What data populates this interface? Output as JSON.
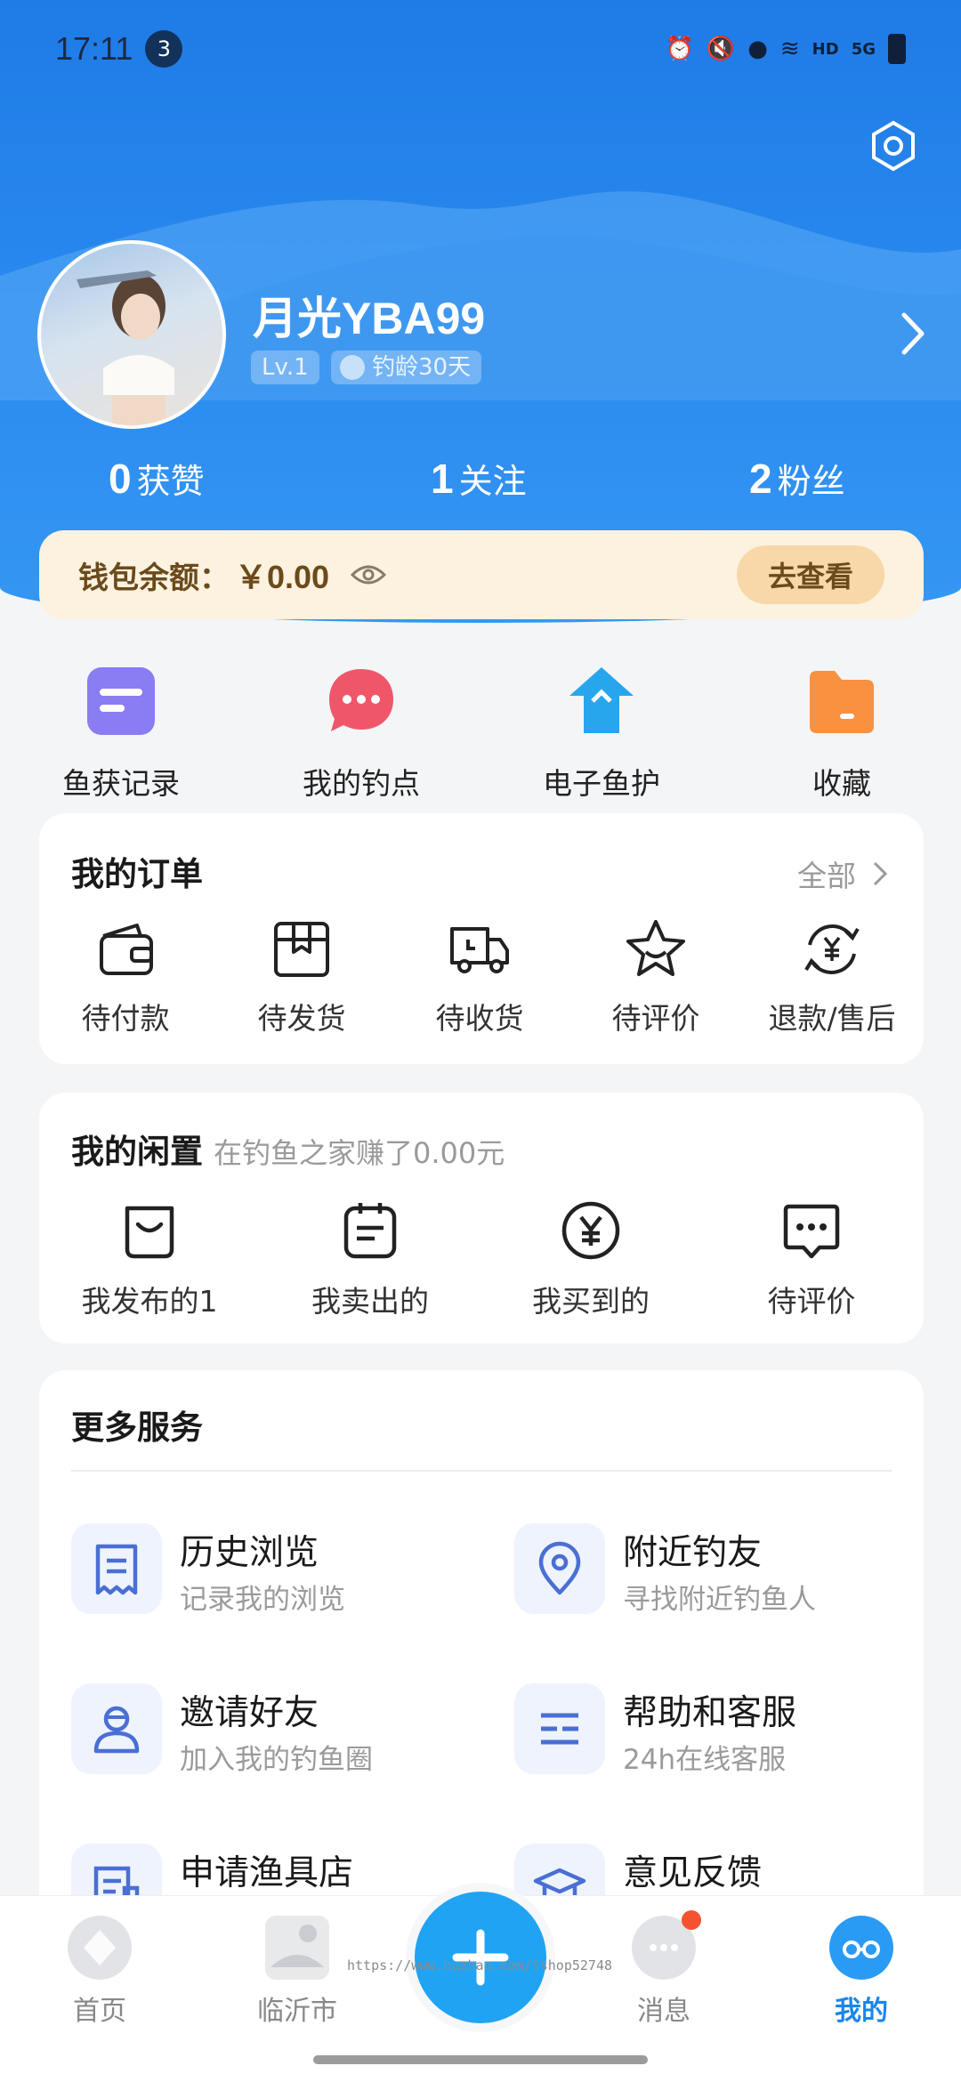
{
  "status_bar": {
    "time": "17:11",
    "notification_count": "3",
    "hd": "HD",
    "signal": "5G"
  },
  "profile": {
    "username": "月光YBA99",
    "level": "Lv.1",
    "fishing_age": "钓龄30天",
    "stats": [
      {
        "num": "0",
        "label": "获赞"
      },
      {
        "num": "1",
        "label": "关注"
      },
      {
        "num": "2",
        "label": "粉丝"
      }
    ]
  },
  "wallet": {
    "label": "钱包余额：",
    "value": "￥0.00",
    "button": "去查看"
  },
  "shortcuts": [
    {
      "label": "鱼获记录",
      "icon": "catch-record-icon",
      "color": "#8a7cf2"
    },
    {
      "label": "我的钓点",
      "icon": "fishing-spot-icon",
      "color": "#f0566a"
    },
    {
      "label": "电子鱼护",
      "icon": "fish-keeper-icon",
      "color": "#27a6ee"
    },
    {
      "label": "收藏",
      "icon": "favorites-icon",
      "color": "#f89140"
    }
  ],
  "orders": {
    "title": "我的订单",
    "more": "全部",
    "items": [
      {
        "label": "待付款",
        "icon": "wallet-icon"
      },
      {
        "label": "待发货",
        "icon": "box-icon"
      },
      {
        "label": "待收货",
        "icon": "truck-icon"
      },
      {
        "label": "待评价",
        "icon": "star-icon"
      },
      {
        "label": "退款/售后",
        "icon": "refund-icon"
      }
    ]
  },
  "idle": {
    "title": "我的闲置",
    "subtitle": "在钓鱼之家赚了0.00元",
    "items": [
      {
        "label": "我发布的1",
        "icon": "bag-icon"
      },
      {
        "label": "我卖出的",
        "icon": "calendar-icon"
      },
      {
        "label": "我买到的",
        "icon": "yen-icon"
      },
      {
        "label": "待评价",
        "icon": "chat-icon"
      }
    ]
  },
  "services": {
    "title": "更多服务",
    "items": [
      {
        "title": "历史浏览",
        "sub": "记录我的浏览",
        "icon": "receipt-icon"
      },
      {
        "title": "附近钓友",
        "sub": "寻找附近钓鱼人",
        "icon": "location-pin-icon"
      },
      {
        "title": "邀请好友",
        "sub": "加入我的钓鱼圈",
        "icon": "user-icon"
      },
      {
        "title": "帮助和客服",
        "sub": "24h在线客服",
        "icon": "list-icon"
      },
      {
        "title": "申请渔具店",
        "sub": "",
        "icon": "shop-doc-icon"
      },
      {
        "title": "意见反馈",
        "sub": "",
        "icon": "graduation-cap-icon"
      }
    ]
  },
  "bottom_nav": [
    {
      "label": "首页",
      "icon": "home-icon"
    },
    {
      "label": "临沂市",
      "icon": "city-icon"
    },
    {
      "label": "消息",
      "icon": "message-icon"
    },
    {
      "label": "我的",
      "icon": "profile-icon"
    }
  ],
  "watermark": "https://www.huzhan.com/ishop52748",
  "colors": {
    "header_blue": "#2a8bf0",
    "accent_blue": "#1a86ea",
    "wallet_bg": "#fdf2df",
    "badge_red": "#f5532f"
  }
}
